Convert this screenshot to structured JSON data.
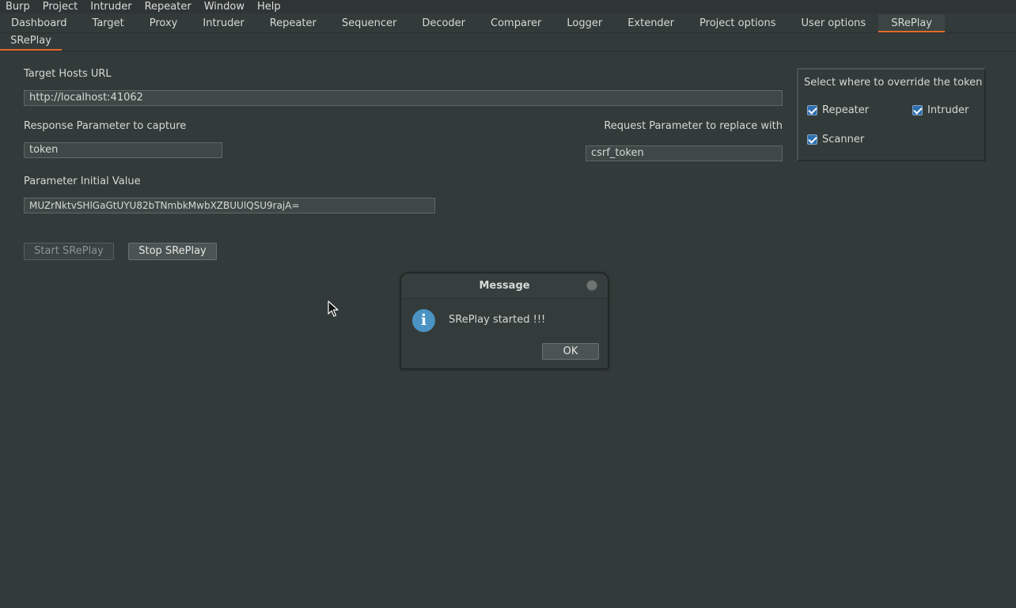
{
  "menubar": [
    "Burp",
    "Project",
    "Intruder",
    "Repeater",
    "Window",
    "Help"
  ],
  "main_tabs": [
    {
      "label": "Dashboard"
    },
    {
      "label": "Target"
    },
    {
      "label": "Proxy"
    },
    {
      "label": "Intruder"
    },
    {
      "label": "Repeater"
    },
    {
      "label": "Sequencer"
    },
    {
      "label": "Decoder"
    },
    {
      "label": "Comparer"
    },
    {
      "label": "Logger"
    },
    {
      "label": "Extender"
    },
    {
      "label": "Project options"
    },
    {
      "label": "User options"
    },
    {
      "label": "SRePlay",
      "active": true
    }
  ],
  "sub_tab": {
    "label": "SRePlay"
  },
  "form": {
    "target_label": "Target Hosts URL",
    "target_value": "http://localhost:41062",
    "response_label": "Response Parameter to capture",
    "response_value": "token",
    "request_label": "Request Parameter to replace with",
    "request_value": "csrf_token",
    "initial_label": "Parameter Initial Value",
    "initial_value": "MUZrNktvSHlGaGtUYU82bTNmbkMwbXZBUUlQSU9rajA="
  },
  "buttons": {
    "start": "Start SRePlay",
    "stop": "Stop SRePlay"
  },
  "override": {
    "title": "Select where to override the token",
    "repeater": "Repeater",
    "intruder": "Intruder",
    "scanner": "Scanner"
  },
  "dialog": {
    "title": "Message",
    "message": "SRePlay started !!!",
    "ok": "OK"
  },
  "colors": {
    "accent": "#e46a2c",
    "background": "#323b39",
    "info": "#4a93c2"
  }
}
